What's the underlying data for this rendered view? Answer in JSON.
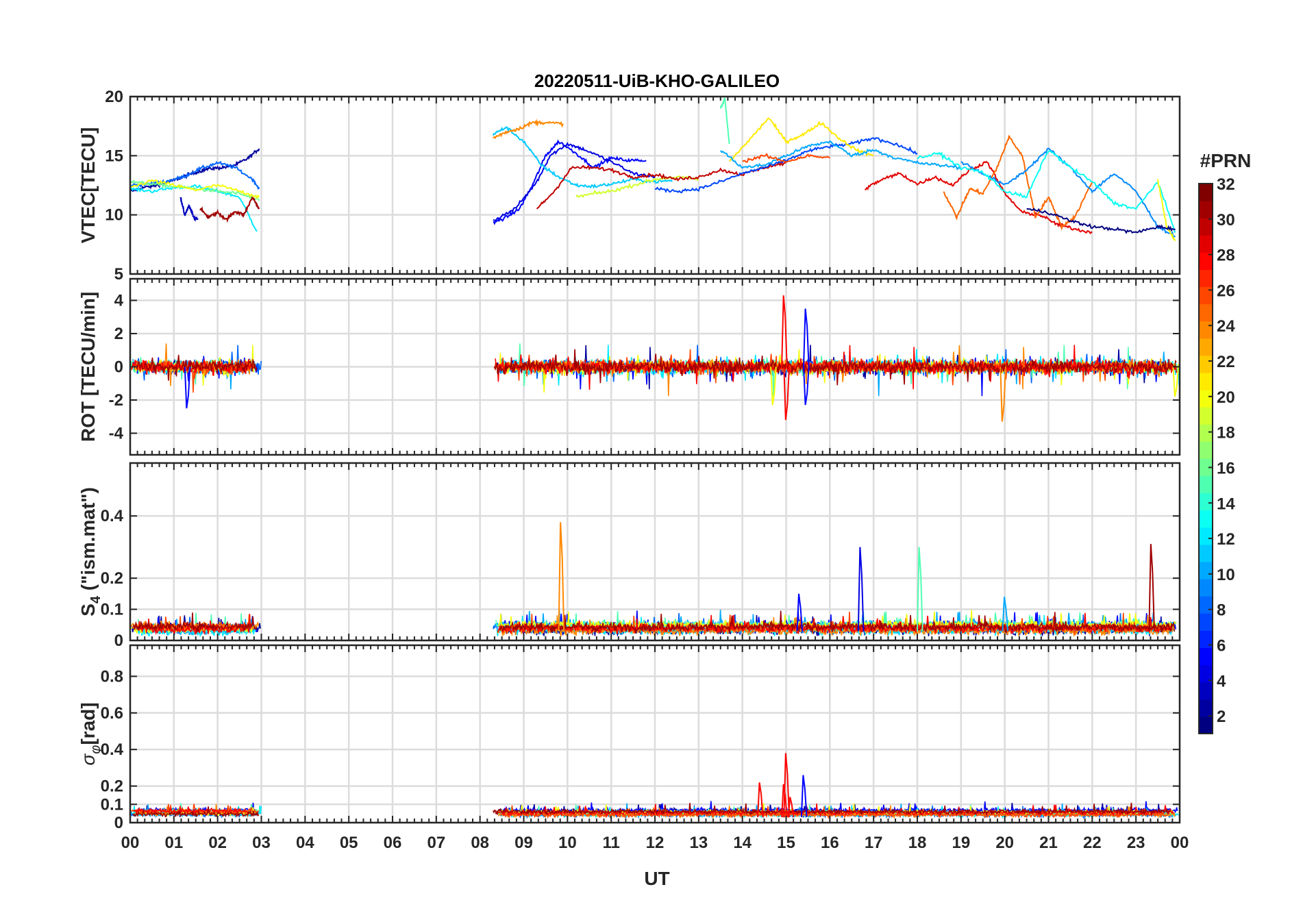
{
  "chart_data": [
    {
      "type": "line",
      "panel": "vtec",
      "title": "20220511-UiB-KHO-GALILEO",
      "ylabel": "VTEC[TECU]",
      "xlabel": "",
      "xlim": [
        0,
        24
      ],
      "ylim": [
        5,
        20
      ],
      "yticks": [
        5,
        10,
        15,
        20
      ],
      "grid": true,
      "series": [
        {
          "prn": 2,
          "x": [
            0.0,
            0.3,
            0.6,
            0.9,
            1.2,
            1.5,
            1.8,
            2.1,
            2.4,
            2.7,
            2.95
          ],
          "y": [
            12.0,
            12.3,
            12.5,
            12.8,
            13.2,
            13.6,
            13.9,
            14.0,
            14.2,
            14.8,
            15.6
          ]
        },
        {
          "prn": 3,
          "x": [
            1.15,
            1.25,
            1.35,
            1.45,
            1.55
          ],
          "y": [
            11.5,
            10.0,
            10.8,
            9.8,
            9.6
          ]
        },
        {
          "prn": 8,
          "x": [
            0.0,
            0.4,
            0.8,
            1.2,
            1.6,
            2.0,
            2.4,
            2.8,
            2.95
          ],
          "y": [
            12.5,
            12.6,
            12.8,
            13.2,
            13.9,
            14.4,
            14.0,
            13.0,
            12.2
          ]
        },
        {
          "prn": 12,
          "x": [
            0.0,
            0.5,
            1.0,
            1.5,
            2.0,
            2.5,
            2.9
          ],
          "y": [
            12.2,
            12.0,
            12.3,
            12.4,
            12.0,
            11.5,
            8.6
          ]
        },
        {
          "prn": 16,
          "x": [
            0.0,
            0.5,
            1.0,
            1.5,
            2.0,
            2.5,
            2.95
          ],
          "y": [
            12.8,
            12.6,
            12.4,
            12.2,
            12.0,
            11.8,
            11.2
          ]
        },
        {
          "prn": 20,
          "x": [
            0.0,
            0.5,
            1.0,
            1.5,
            2.0,
            2.5,
            2.95
          ],
          "y": [
            12.3,
            12.9,
            12.5,
            12.1,
            12.5,
            12.0,
            11.5
          ]
        },
        {
          "prn": 31,
          "x": [
            1.6,
            1.8,
            2.0,
            2.2,
            2.4,
            2.6,
            2.8,
            2.95
          ],
          "y": [
            10.5,
            9.8,
            10.2,
            9.6,
            10.3,
            10.0,
            11.5,
            10.5
          ]
        },
        {
          "prn": 5,
          "x": [
            8.3,
            8.6,
            8.9,
            9.2,
            9.5,
            9.8,
            10.2,
            10.6,
            11.0,
            11.4,
            11.8
          ],
          "y": [
            9.3,
            9.8,
            10.5,
            12.5,
            15.0,
            16.2,
            15.2,
            14.0,
            14.8,
            14.6,
            14.6
          ]
        },
        {
          "prn": 4,
          "x": [
            8.3,
            8.8,
            9.3,
            9.6,
            10.0,
            10.4,
            11.0,
            11.5,
            12.0
          ],
          "y": [
            9.5,
            10.5,
            12.8,
            15.0,
            16.0,
            15.5,
            14.5,
            13.5,
            13.2
          ]
        },
        {
          "prn": 11,
          "x": [
            8.3,
            8.6,
            9.0,
            9.4,
            9.8,
            10.2,
            10.6,
            11.0,
            11.5,
            12.0,
            12.4
          ],
          "y": [
            16.8,
            17.4,
            16.2,
            14.2,
            13.2,
            12.5,
            12.4,
            12.6,
            13.0,
            12.8,
            12.9
          ]
        },
        {
          "prn": 24,
          "x": [
            8.3,
            8.6,
            8.9,
            9.2,
            9.5,
            9.9
          ],
          "y": [
            16.5,
            17.0,
            17.3,
            17.8,
            17.8,
            17.7
          ]
        },
        {
          "prn": 19,
          "x": [
            10.2,
            10.6,
            11.0,
            11.5,
            12.0,
            12.5,
            13.0
          ],
          "y": [
            11.5,
            11.8,
            12.0,
            12.5,
            13.0,
            13.2,
            13.0
          ]
        },
        {
          "prn": 30,
          "x": [
            9.3,
            9.7,
            10.1,
            10.5,
            11.0,
            11.5,
            12.0,
            12.5,
            13.0,
            13.5,
            14.0,
            14.5,
            15.0
          ],
          "y": [
            10.5,
            12.0,
            14.0,
            14.0,
            13.8,
            13.2,
            13.4,
            13.0,
            13.2,
            13.8,
            13.4,
            14.0,
            14.4
          ]
        },
        {
          "prn": 7,
          "x": [
            12.0,
            12.5,
            13.0,
            13.5,
            14.0,
            14.5,
            15.0,
            15.5,
            16.0,
            16.5,
            17.0,
            17.5,
            18.0
          ],
          "y": [
            12.2,
            12.0,
            12.2,
            12.8,
            13.5,
            14.0,
            14.6,
            15.4,
            15.8,
            16.0,
            16.5,
            16.0,
            15.2
          ]
        },
        {
          "prn": 15,
          "x": [
            13.5,
            13.6,
            13.7
          ],
          "y": [
            19.0,
            19.8,
            16.0
          ]
        },
        {
          "prn": 21,
          "x": [
            13.7,
            14.2,
            14.6,
            15.0,
            15.4,
            15.8,
            16.2,
            16.6,
            17.0
          ],
          "y": [
            14.5,
            16.5,
            18.2,
            16.2,
            16.8,
            17.8,
            16.5,
            15.5,
            15.0
          ]
        },
        {
          "prn": 10,
          "x": [
            13.5,
            14.0,
            14.5,
            15.0,
            15.5,
            16.0,
            16.5,
            17.0,
            17.5,
            18.0,
            18.5,
            19.0
          ],
          "y": [
            15.5,
            14.0,
            14.2,
            15.0,
            15.8,
            16.2,
            15.0,
            15.5,
            14.8,
            14.4,
            14.2,
            14.0
          ]
        },
        {
          "prn": 26,
          "x": [
            14.0,
            14.5,
            15.0,
            15.5,
            16.0
          ],
          "y": [
            14.5,
            15.0,
            14.5,
            15.0,
            14.8
          ]
        },
        {
          "prn": 29,
          "x": [
            16.8,
            17.2,
            17.6,
            18.0,
            18.4,
            18.8,
            19.2,
            19.6,
            20.0,
            20.4,
            20.8,
            21.2,
            21.6,
            22.0
          ],
          "y": [
            12.2,
            13.0,
            13.5,
            12.6,
            13.2,
            12.5,
            13.8,
            14.5,
            11.8,
            10.2,
            10.0,
            9.2,
            8.8,
            8.5
          ]
        },
        {
          "prn": 25,
          "x": [
            18.6,
            18.9,
            19.2,
            19.5,
            19.8,
            20.1,
            20.4,
            20.7,
            21.0,
            21.3,
            21.6,
            22.0
          ],
          "y": [
            12.0,
            9.8,
            12.2,
            11.8,
            13.8,
            16.6,
            15.0,
            9.8,
            11.5,
            9.0,
            9.8,
            12.8
          ]
        },
        {
          "prn": 9,
          "x": [
            19.0,
            19.5,
            20.0,
            20.5,
            21.0,
            21.5,
            22.0,
            22.5,
            23.0,
            23.5,
            23.9
          ],
          "y": [
            14.5,
            13.5,
            12.5,
            13.8,
            15.6,
            14.0,
            12.0,
            13.5,
            12.0,
            9.0,
            8.2
          ]
        },
        {
          "prn": 13,
          "x": [
            18.0,
            18.5,
            19.0,
            19.5,
            20.0,
            20.5,
            21.0,
            21.5,
            22.0,
            22.5,
            23.0,
            23.5,
            23.9
          ],
          "y": [
            14.8,
            15.2,
            14.0,
            13.6,
            12.0,
            11.5,
            15.5,
            14.0,
            12.8,
            11.0,
            10.5,
            12.8,
            8.5
          ]
        },
        {
          "prn": 20,
          "x": [
            23.5,
            23.7,
            23.9
          ],
          "y": [
            13.0,
            9.0,
            7.8
          ]
        },
        {
          "prn": 1,
          "x": [
            20.5,
            21.0,
            21.5,
            22.0,
            22.5,
            23.0,
            23.5,
            23.9
          ],
          "y": [
            10.5,
            10.2,
            9.5,
            9.0,
            8.8,
            8.5,
            9.0,
            8.8
          ]
        }
      ]
    },
    {
      "type": "line",
      "panel": "rot",
      "ylabel": "ROT [TECU/min]",
      "xlim": [
        0,
        24
      ],
      "ylim": [
        -5.3,
        5.3
      ],
      "yticks": [
        -4,
        -2,
        0,
        2,
        4
      ],
      "grid": true,
      "segments": [
        [
          0,
          3
        ],
        [
          8.3,
          24
        ]
      ],
      "spikes": [
        {
          "prn": 5,
          "x": 1.3,
          "y": -2.5
        },
        {
          "prn": 28,
          "x": 14.95,
          "y": 4.3
        },
        {
          "prn": 28,
          "x": 15.0,
          "y": -3.2
        },
        {
          "prn": 5,
          "x": 15.45,
          "y": 3.5
        },
        {
          "prn": 5,
          "x": 15.45,
          "y": -2.3
        },
        {
          "prn": 24,
          "x": 19.95,
          "y": -3.3
        },
        {
          "prn": 20,
          "x": 14.7,
          "y": -2.3
        },
        {
          "prn": 20,
          "x": 23.9,
          "y": -1.8
        }
      ]
    },
    {
      "type": "line",
      "panel": "s4",
      "ylabel": "S4 (\"ism.mat\")",
      "xlim": [
        0,
        24
      ],
      "ylim": [
        0,
        0.57
      ],
      "yticks": [
        0,
        0.1,
        0.2,
        0.4
      ],
      "grid": true,
      "segments": [
        [
          0,
          3
        ],
        [
          8.3,
          24
        ]
      ],
      "spikes": [
        {
          "prn": 24,
          "x": 9.85,
          "y": 0.38
        },
        {
          "prn": 4,
          "x": 16.7,
          "y": 0.3
        },
        {
          "prn": 15,
          "x": 18.05,
          "y": 0.3
        },
        {
          "prn": 31,
          "x": 23.35,
          "y": 0.31
        },
        {
          "prn": 5,
          "x": 15.3,
          "y": 0.15
        },
        {
          "prn": 10,
          "x": 20.0,
          "y": 0.14
        }
      ]
    },
    {
      "type": "line",
      "panel": "sigma",
      "ylabel": "σφ[rad]",
      "xlabel": "UT",
      "xlim": [
        0,
        24
      ],
      "ylim": [
        0,
        0.97
      ],
      "yticks": [
        0,
        0.1,
        0.2,
        0.4,
        0.6,
        0.8
      ],
      "xticks": [
        "00",
        "01",
        "02",
        "03",
        "04",
        "05",
        "06",
        "07",
        "08",
        "09",
        "10",
        "11",
        "12",
        "13",
        "14",
        "15",
        "16",
        "17",
        "18",
        "19",
        "20",
        "21",
        "22",
        "23",
        "00"
      ],
      "grid": true,
      "segments": [
        [
          0,
          3
        ],
        [
          8.3,
          24
        ]
      ],
      "spikes": [
        {
          "prn": 28,
          "x": 14.4,
          "y": 0.22
        },
        {
          "prn": 28,
          "x": 14.95,
          "y": 0.21
        },
        {
          "prn": 28,
          "x": 15.0,
          "y": 0.38
        },
        {
          "prn": 28,
          "x": 15.1,
          "y": 0.14
        },
        {
          "prn": 5,
          "x": 15.4,
          "y": 0.26
        }
      ]
    }
  ],
  "colorbar": {
    "title": "#PRN",
    "range": [
      1,
      32
    ],
    "ticks": [
      2,
      4,
      6,
      8,
      10,
      12,
      14,
      16,
      18,
      20,
      22,
      24,
      26,
      28,
      30,
      32
    ],
    "colormap": "jet"
  }
}
